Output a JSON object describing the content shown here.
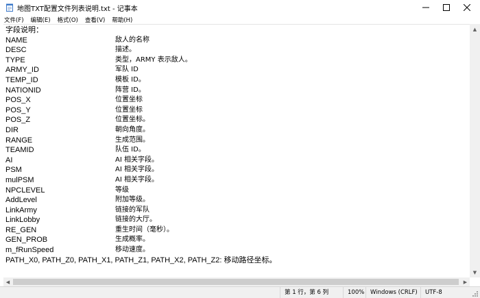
{
  "window": {
    "title": "地图TXT配置文件列表说明.txt - 记事本"
  },
  "menu": [
    "文件(F)",
    "编辑(E)",
    "格式(O)",
    "查看(V)",
    "帮助(H)"
  ],
  "content": {
    "heading": "字段说明：",
    "fields": [
      {
        "key": "NAME",
        "desc": "敌人的名称"
      },
      {
        "key": "DESC",
        "desc": "描述。"
      },
      {
        "key": "TYPE",
        "desc": "类型，ARMY 表示敌人。"
      },
      {
        "key": "ARMY_ID",
        "desc": "军队 ID"
      },
      {
        "key": "TEMP_ID",
        "desc": "模板 ID。"
      },
      {
        "key": "NATIONID",
        "desc": "阵营 ID。"
      },
      {
        "key": "POS_X",
        "desc": "位置坐标"
      },
      {
        "key": "POS_Y",
        "desc": "位置坐标"
      },
      {
        "key": "POS_Z",
        "desc": "位置坐标。"
      },
      {
        "key": "DIR",
        "desc": " 朝向角度。"
      },
      {
        "key": "RANGE",
        "desc": " 生成范围。"
      },
      {
        "key": "TEAMID",
        "desc": " 队伍 ID。"
      },
      {
        "key": "AI",
        "desc": "AI 相关字段。"
      },
      {
        "key": "PSM",
        "desc": "AI 相关字段。"
      },
      {
        "key": "mulPSM",
        "desc": "AI 相关字段。"
      },
      {
        "key": "NPCLEVEL",
        "desc": "等级"
      },
      {
        "key": "AddLevel",
        "desc": "附加等级。"
      },
      {
        "key": "LinkArmy",
        "desc": "链接的军队"
      },
      {
        "key": "LinkLobby",
        "desc": "链接的大厅。"
      },
      {
        "key": "RE_GEN",
        "desc": " 重生时间（毫秒）。"
      },
      {
        "key": "GEN_PROB",
        "desc": "生成概率。"
      },
      {
        "key": "m_fRunSpeed",
        "desc": " 移动速度。"
      }
    ],
    "footer_line": "PATH_X0, PATH_Z0, PATH_X1, PATH_Z1, PATH_X2, PATH_Z2: 移动路径坐标。"
  },
  "status": {
    "position": "第 1 行，第 6 列",
    "zoom": "100%",
    "line_ending": "Windows (CRLF)",
    "encoding": "UTF-8"
  }
}
